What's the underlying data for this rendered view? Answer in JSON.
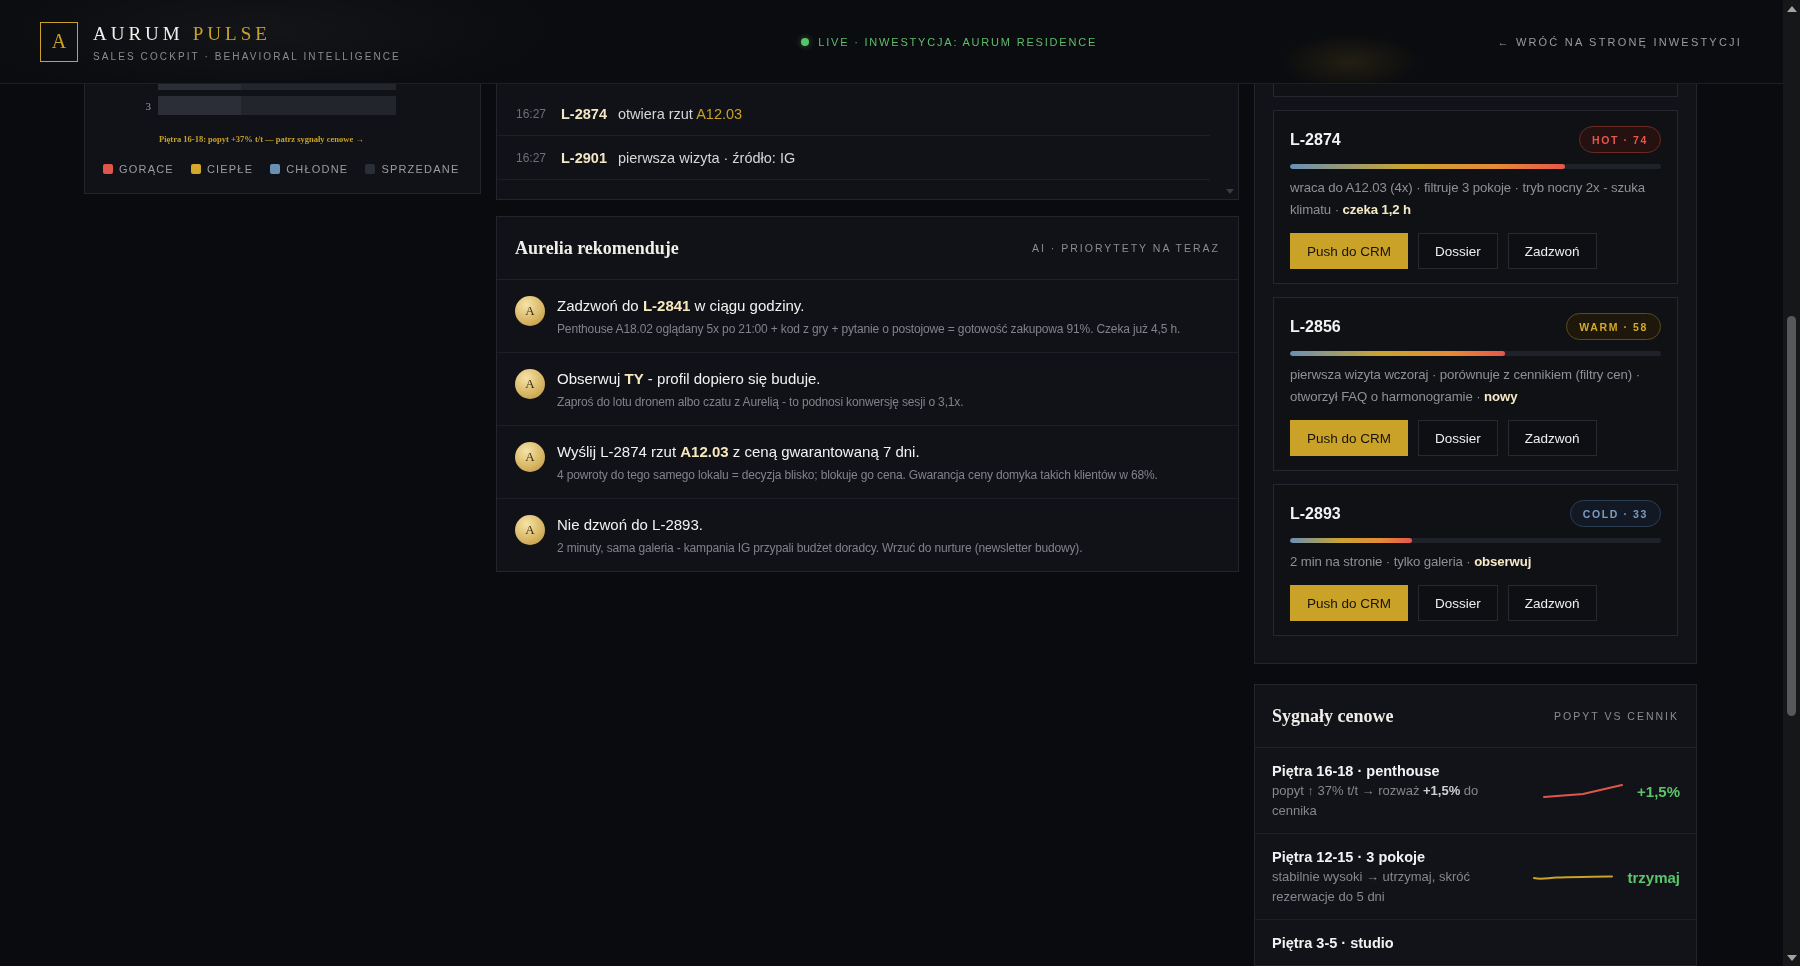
{
  "header": {
    "logo": "A",
    "brand": "AURUM",
    "brand_accent": "PULSE",
    "tagline": "SALES COCKPIT · BEHAVIORAL INTELLIGENCE",
    "live": true,
    "status": "LIVE · INWESTYCJA: AURUM RESIDENCE",
    "back_link": "← WRÓĆ NA STRONĘ INWESTYCJI"
  },
  "floor_map": {
    "floors": [
      {
        "level": 0.35
      },
      {
        "label": "3",
        "level": 0.35
      }
    ],
    "note": "Piętra 16-18: popyt +37% t/t — patrz sygnały cenowe →",
    "legend": [
      {
        "label": "GORĄCE",
        "color": "#e0574a"
      },
      {
        "label": "CIEPŁE",
        "color": "#d4a82a"
      },
      {
        "label": "CHŁODNE",
        "color": "#6a8fb5"
      },
      {
        "label": "SPRZEDANE",
        "color": "#2a2e38"
      }
    ]
  },
  "live_feed": {
    "events": [
      {
        "time": "16:27",
        "lead": "L-2874",
        "text": "otwiera rzut",
        "highlight": "A12.03"
      },
      {
        "time": "16:27",
        "lead": "L-2901",
        "text": "pierwsza wizyta · źródło: IG"
      }
    ]
  },
  "recommendations": {
    "title": "Aurelia rekomenduje",
    "subtitle": "AI · PRIORYTETY NA TERAZ",
    "items": [
      {
        "avatar": "A",
        "title": "Zadzwoń do **L-2841** w ciągu godziny.",
        "detail": "Penthouse A18.02 oglądany 5x po 21:00 + kod z gry + pytanie o postojowe = gotowość zakupowa 91%. Czeka już 4,5 h."
      },
      {
        "avatar": "A",
        "title": "Obserwuj **TY** - profil dopiero się buduje.",
        "detail": "Zaproś do lotu dronem albo czatu z Aurelią - to podnosi konwersję sesji o 3,1x."
      },
      {
        "avatar": "A",
        "title": "Wyślij L-2874 rzut **A12.03** z ceną gwarantowaną 7 dni.",
        "detail": "4 powroty do tego samego lokalu = decyzja blisko; blokuje go cena. Gwarancja ceny domyka takich klientów w 68%."
      },
      {
        "avatar": "A",
        "title": "Nie dzwoń do L-2893.",
        "detail": "2 minuty, sama galeria - kampania IG przypali budżet doradcy. Wrzuć do nurture (newsletter budowy)."
      }
    ]
  },
  "leads": [
    {
      "id": "L-2874",
      "kind": "hot",
      "badge": "HOT · 74",
      "level": 0.74,
      "description": "wraca do A12.03 (4x) · filtruje 3 pokoje · tryb nocny 2x - szuka klimatu · **czeka 1,2 h**",
      "actions": [
        {
          "label": "Push do CRM",
          "primary": true
        },
        {
          "label": "Dossier",
          "primary": false
        },
        {
          "label": "Zadzwoń",
          "primary": false
        }
      ]
    },
    {
      "id": "L-2856",
      "kind": "warm",
      "badge": "WARM · 58",
      "level": 0.58,
      "description": "pierwsza wizyta wczoraj · porównuje z cennikiem (filtry cen) · otworzył FAQ o harmonogramie · **nowy**",
      "actions": [
        {
          "label": "Push do CRM",
          "primary": true
        },
        {
          "label": "Dossier",
          "primary": false
        },
        {
          "label": "Zadzwoń",
          "primary": false
        }
      ]
    },
    {
      "id": "L-2893",
      "kind": "cold",
      "badge": "COLD · 33",
      "level": 0.33,
      "description": "2 min na stronie · tylko galeria · **obserwuj**",
      "actions": [
        {
          "label": "Push do CRM",
          "primary": true
        },
        {
          "label": "Dossier",
          "primary": false
        },
        {
          "label": "Zadzwoń",
          "primary": false
        }
      ]
    }
  ],
  "price_signals": {
    "title": "Sygnały cenowe",
    "subtitle": "POPYT VS CENNIK",
    "rows": [
      {
        "title": "Piętra 16-18 · penthouse",
        "description": "popyt ↑ 37% t/t → rozważ **+1,5%** do cennika",
        "kind": "up",
        "color": "#e0574a",
        "signal": "+1,5%"
      },
      {
        "title": "Piętra 12-15 · 3 pokoje",
        "description": "stabilnie wysoki → utrzymaj, skróć rezerwacje do 5 dni",
        "kind": "flat",
        "color": "#c9a227",
        "signal": "trzymaj"
      },
      {
        "title": "Piętra 3-5 · studio"
      }
    ]
  }
}
